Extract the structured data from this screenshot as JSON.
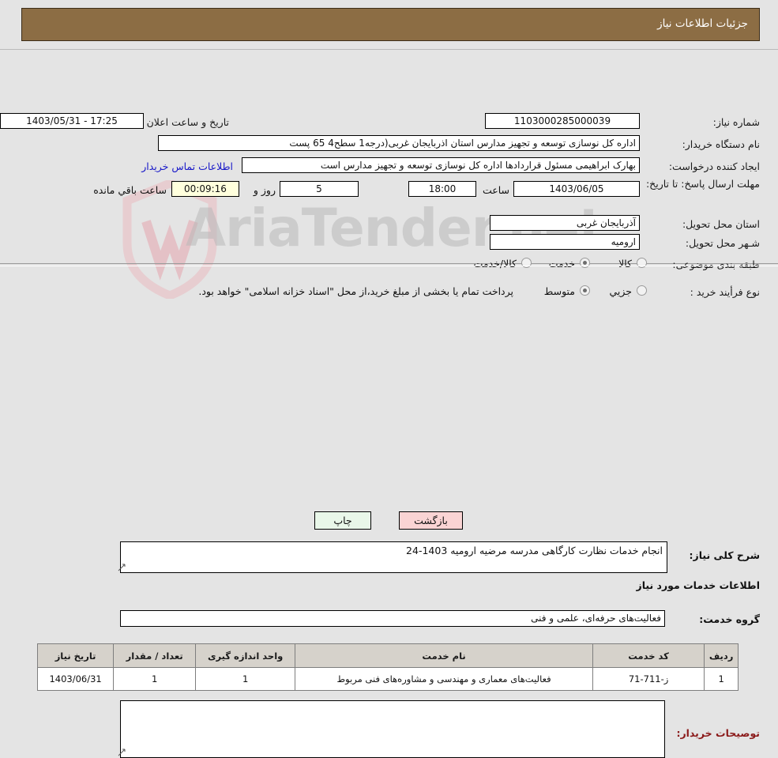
{
  "header": {
    "title": "جزئیات اطلاعات نیاز"
  },
  "watermark": {
    "text": "AriaTender.net"
  },
  "form": {
    "need_number_label": "شماره نیاز:",
    "need_number_value": "1103000285000039",
    "announce_datetime_label": "تاریخ و ساعت اعلان عمومی:",
    "announce_datetime_value": "1403/05/31 - 17:25",
    "buyer_org_label": "نام دستگاه خریدار:",
    "buyer_org_value": "اداره کل نوسازی   توسعه و تجهیز مدارس استان اذربایجان غربی(درجه1  سطح4  65 پست",
    "requester_label": "ایجاد کننده درخواست:",
    "requester_value": "بهارک ابراهیمی مسئول قراردادها اداره کل نوسازی   توسعه و تجهیز مدارس است",
    "contact_link": "اطلاعات تماس خریدار",
    "deadline_label": "مهلت ارسال پاسخ: تا تاریخ:",
    "deadline_date": "1403/06/05",
    "deadline_hour_label": "ساعت",
    "deadline_time": "18:00",
    "remaining_days": "5",
    "remaining_days_label": "روز و",
    "remaining_time": "00:09:16",
    "remaining_suffix": "ساعت باقي مانده",
    "province_label": "استان محل تحویل:",
    "province_value": "آذربایجان غربی",
    "city_label": "شـهر محل تحویل:",
    "city_value": "ارومیه",
    "category_label": "طبقه بندی موضوعی:",
    "category_options": [
      {
        "label": "کالا",
        "selected": false
      },
      {
        "label": "خدمت",
        "selected": true
      },
      {
        "label": "کالا/خدمت",
        "selected": false
      }
    ],
    "process_label": "نوع فرأیند خرید :",
    "process_options": [
      {
        "label": "جزیي",
        "selected": false
      },
      {
        "label": "متوسط",
        "selected": true
      }
    ],
    "payment_note": "پرداخت تمام یا بخشی از مبلغ خرید،از محل \"اسناد خزانه اسلامی\" خواهد بود.",
    "general_desc_label": "شرح کلی نیاز:",
    "general_desc_value": "انجام خدمات نظارت کارگاهی مدرسه مرضیه ارومیه 1403-24",
    "services_section_title": "اطلاعات خدمات مورد نیاز",
    "service_group_label": "گروه خدمت:",
    "service_group_value": "فعالیت‌های حرفه‌ای، علمی و فنی",
    "buyer_remarks_label": "توصیحات خریدار:",
    "buyer_remarks_value": ""
  },
  "table": {
    "columns": [
      "ردیف",
      "کد خدمت",
      "نام خدمت",
      "واحد اندازه گیری",
      "تعداد / مقدار",
      "تاریخ نیاز"
    ],
    "rows": [
      {
        "row_no": "1",
        "service_code": "ز-711-71",
        "service_name": "فعالیت‌های معماری و مهندسی و مشاوره‌های فنی مربوط",
        "unit": "1",
        "quantity": "1",
        "need_date": "1403/06/31"
      }
    ]
  },
  "footer": {
    "print_label": "چاپ",
    "back_label": "بازگشت"
  },
  "colors": {
    "header_bar": "#8c6d44",
    "link": "#1818c8",
    "remarks_label": "#8b1a1a",
    "countdown_bg": "#ffffdd",
    "print_btn": "#e9f7e9",
    "back_btn": "#fad4d4",
    "page_bg": "#e4e4e4",
    "table_header_bg": "#d6d2cb"
  }
}
